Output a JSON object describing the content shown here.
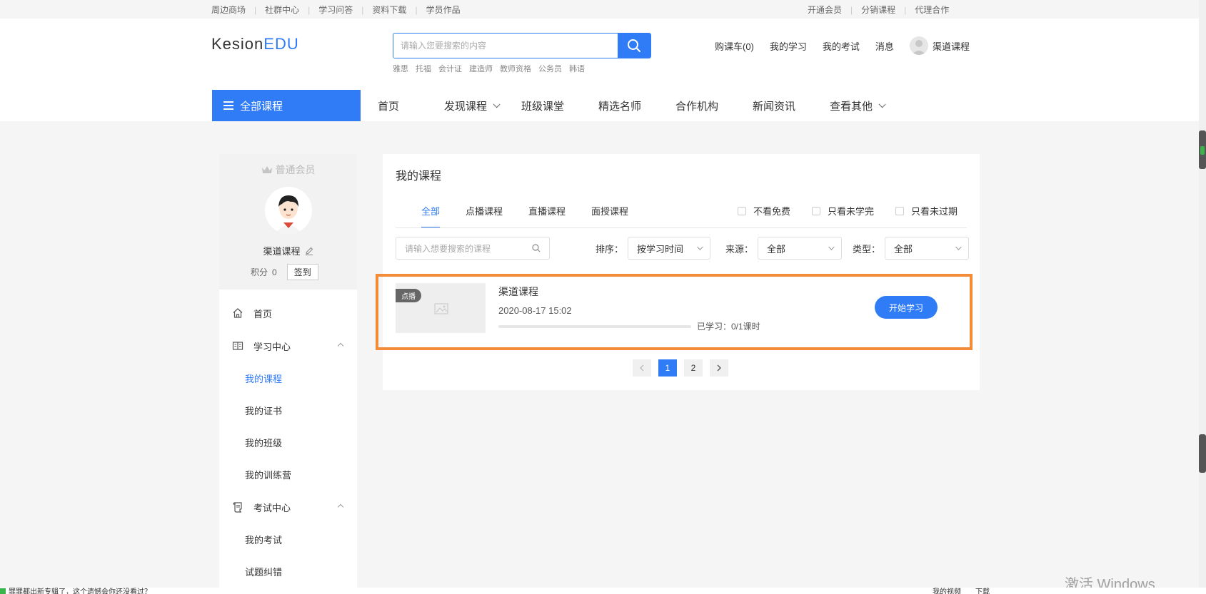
{
  "topbar": {
    "left_links": [
      "周边商场",
      "社群中心",
      "学习问答",
      "资料下载",
      "学员作品"
    ],
    "right_links": [
      "开通会员",
      "分销课程",
      "代理合作"
    ]
  },
  "header": {
    "logo_part1": "Kesion",
    "logo_part2": "EDU",
    "search_placeholder": "请输入您要搜索的内容",
    "hot_words": [
      "雅思",
      "托福",
      "会计证",
      "建造师",
      "教师资格",
      "公务员",
      "韩语"
    ],
    "cart": "购课车(0)",
    "my_learning": "我的学习",
    "my_exams": "我的考试",
    "messages": "消息",
    "username": "渠道课程"
  },
  "mainnav": {
    "all_courses": "全部课程",
    "links": [
      "首页",
      "发现课程",
      "班级课堂",
      "精选名师",
      "合作机构",
      "新闻资讯",
      "查看其他"
    ]
  },
  "sidebar": {
    "member_level": "普通会员",
    "username": "渠道课程",
    "points_label": "积分",
    "points_value": "0",
    "checkin_label": "签到",
    "home": "首页",
    "learning_center": "学习中心",
    "learning_items": [
      "我的课程",
      "我的证书",
      "我的班级",
      "我的训练营"
    ],
    "exam_center": "考试中心",
    "exam_items": [
      "我的考试",
      "试题纠错"
    ]
  },
  "main": {
    "title": "我的课程",
    "tabs": [
      "全部",
      "点播课程",
      "直播课程",
      "面授课程"
    ],
    "filters": [
      "不看免费",
      "只看未学完",
      "只看未过期"
    ],
    "course_search_placeholder": "请输入想要搜索的课程",
    "sort_label": "排序：",
    "sort_value": "按学习时间",
    "source_label": "来源：",
    "source_value": "全部",
    "type_label": "类型：",
    "type_value": "全部",
    "course": {
      "badge": "点播",
      "title": "渠道课程",
      "date": "2020-08-17 15:02",
      "progress_text": "已学习：0/1课时",
      "progress_fraction": 0,
      "button": "开始学习"
    },
    "pagination": [
      "1",
      "2"
    ]
  },
  "statusbar": {
    "left_text": "罪罪都出新专辑了，这个遗憾会你还没看过？",
    "right_items": [
      "我的视频",
      "下载"
    ]
  },
  "watermark": "激活 Windows",
  "colors": {
    "accent": "#2f7cf6",
    "highlight": "#f28c38"
  }
}
